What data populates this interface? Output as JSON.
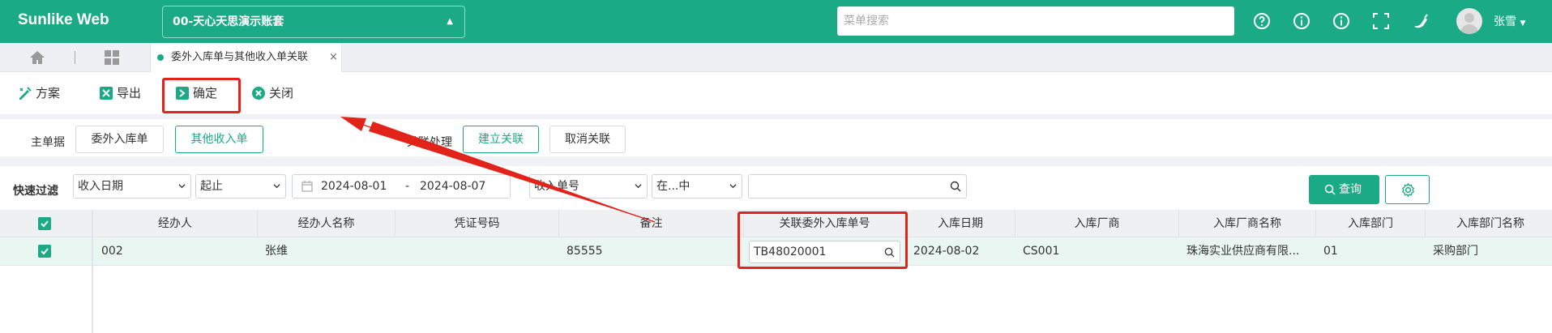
{
  "app": {
    "brand": "Sunlike Web",
    "account": "00-天心天思演示账套",
    "menu_search_placeholder": "菜单搜索",
    "user_name": "张雪",
    "accent_color": "#1aab86"
  },
  "tabs": {
    "active_tab": "委外入库单与其他收入单关联",
    "close_symbol": "×"
  },
  "toolbar": {
    "scheme": "方案",
    "export": "导出",
    "confirm": "确定",
    "close": "关闭"
  },
  "relation": {
    "master_label": "主单据",
    "btn_outsource": "委外入库单",
    "btn_other_income": "其他收入单",
    "process_label": "关联处理",
    "btn_create": "建立关联",
    "btn_cancel": "取消关联"
  },
  "filter": {
    "label": "快速过滤",
    "field1": "收入日期",
    "op1": "起止",
    "date_from": "2024-08-01",
    "date_sep": "-",
    "date_to": "2024-08-07",
    "field2": "收入单号",
    "op2": "在...中",
    "value2": "",
    "query": "查询"
  },
  "grid": {
    "columns": [
      "经办人",
      "经办人名称",
      "凭证号码",
      "备注",
      "关联委外入库单号",
      "入库日期",
      "入库厂商",
      "入库厂商名称",
      "入库部门",
      "入库部门名称"
    ],
    "rows": [
      {
        "checked": true,
        "cells": [
          "002",
          "张维",
          "",
          "85555",
          "TB48020001",
          "2024-08-02",
          "CS001",
          "珠海实业供应商有限...",
          "01",
          "采购部门"
        ]
      }
    ]
  }
}
